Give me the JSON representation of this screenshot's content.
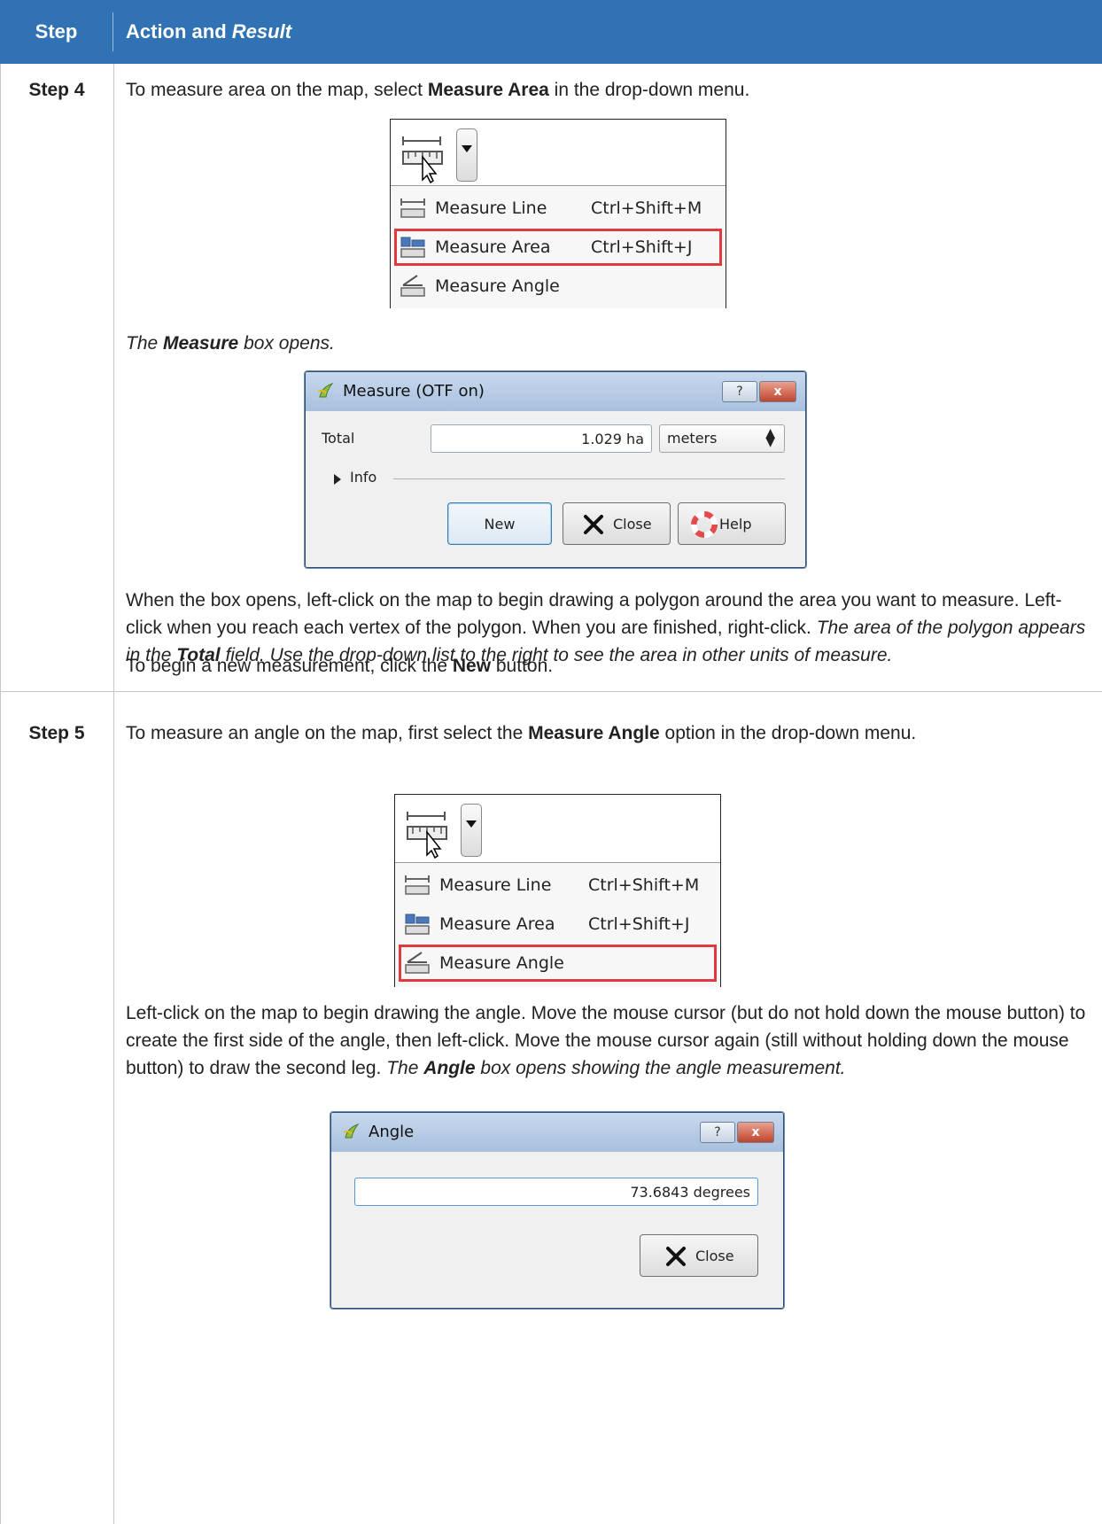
{
  "header": {
    "step_col": "Step",
    "action_col_plain": "Action and ",
    "action_col_italic": "Result"
  },
  "step4": {
    "label": "Step 4",
    "intro_pre": "To measure area on the map, select ",
    "intro_bold": "Measure Area",
    "intro_post": " in the drop-down menu.",
    "menu": [
      {
        "label": "Measure Line",
        "shortcut": "Ctrl+Shift+M",
        "icon": "measure-line-icon",
        "selected": false
      },
      {
        "label": "Measure Area",
        "shortcut": "Ctrl+Shift+J",
        "icon": "measure-area-icon",
        "selected": true
      },
      {
        "label": "Measure Angle",
        "shortcut": "",
        "icon": "measure-angle-icon",
        "selected": false
      }
    ],
    "result_pre": "The ",
    "result_bold": "Measure",
    "result_post": " box opens.",
    "dialog": {
      "title": "Measure (OTF on)",
      "help_glyph": "?",
      "close_glyph": "x",
      "total_label": "Total",
      "total_value": "1.029 ha",
      "unit_value": "meters",
      "info_label": "Info",
      "new_button": "New",
      "close_button": "Close",
      "help_button": "Help"
    },
    "para1_a": "When the box opens, left-click on the map to begin drawing a polygon around the area you want to measure. Left-click when you reach each vertex of the polygon. When you are finished, right-click. ",
    "para1_i1": "The area of the polygon appears in the ",
    "para1_ib": "Total",
    "para1_i2": " field. Use the drop-down list to the right to see the area in other units of measure.",
    "para2_pre": "To begin a new measurement, click the ",
    "para2_bold": "New",
    "para2_post": " button."
  },
  "step5": {
    "label": "Step 5",
    "intro_pre": "To measure an angle on the map, first select the ",
    "intro_bold": "Measure Angle",
    "intro_post": " option in the drop-down menu.",
    "menu": [
      {
        "label": "Measure Line",
        "shortcut": "Ctrl+Shift+M",
        "icon": "measure-line-icon",
        "selected": false
      },
      {
        "label": "Measure Area",
        "shortcut": "Ctrl+Shift+J",
        "icon": "measure-area-icon",
        "selected": false
      },
      {
        "label": "Measure Angle",
        "shortcut": "",
        "icon": "measure-angle-icon",
        "selected": true
      }
    ],
    "para_a": "Left-click on the map to begin drawing the angle. Move the mouse cursor (but do not hold down the mouse button) to create the first side of the angle, then left-click. Move the mouse cursor again (still without holding down the mouse button) to draw the second leg. ",
    "para_i1": "The ",
    "para_ib": "Angle",
    "para_i2": " box opens showing the angle measurement.",
    "dialog": {
      "title": "Angle",
      "help_glyph": "?",
      "close_glyph": "x",
      "value": "73.6843 degrees",
      "close_button": "Close"
    }
  },
  "colors": {
    "header_bg": "#3072b3",
    "highlight": "#e2393f"
  }
}
